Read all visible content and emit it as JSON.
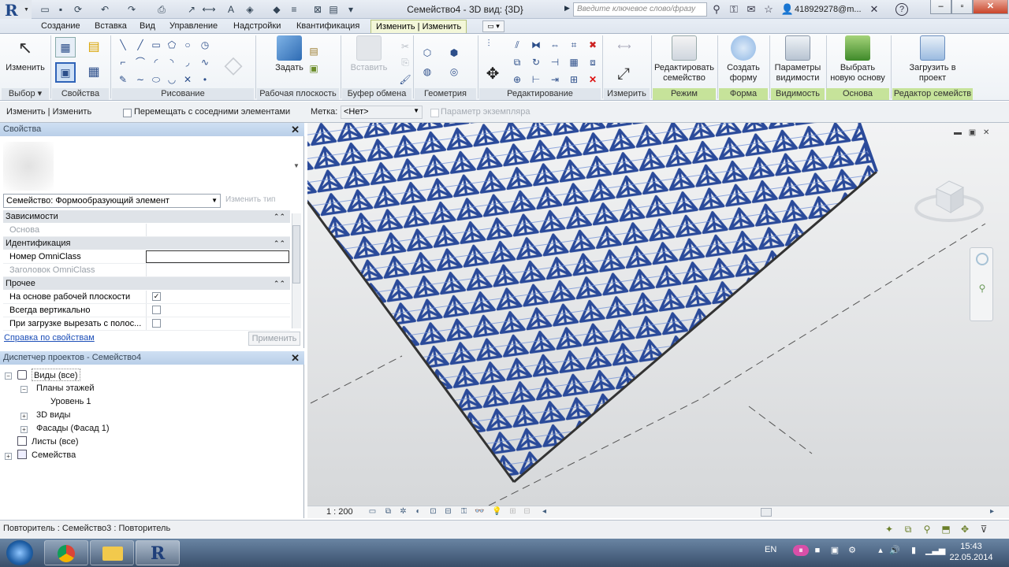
{
  "titlebar": {
    "title": "Семейство4 - 3D вид: {3D}",
    "search_placeholder": "Введите ключевое слово/фразу",
    "user": "418929278@m...",
    "help": "?"
  },
  "tabs": [
    {
      "label": "Создание"
    },
    {
      "label": "Вставка"
    },
    {
      "label": "Вид"
    },
    {
      "label": "Управление"
    },
    {
      "label": "Надстройки"
    },
    {
      "label": "Квантификация"
    },
    {
      "label": "Изменить | Изменить"
    }
  ],
  "ribbon": {
    "modify_label": "Изменить",
    "plane_set_label": "Задать",
    "paste_label": "Вставить",
    "edit_profile_label": "Редактировать семейство",
    "create_form_label": "Создать форму",
    "visibility_label": "Параметры видимости",
    "pick_host_label": "Выбрать новую основу",
    "load_label": "Загрузить в проект",
    "panels": [
      {
        "label": "Выбор"
      },
      {
        "label": "Свойства"
      },
      {
        "label": "Рисование"
      },
      {
        "label": "Рабочая плоскость"
      },
      {
        "label": "Буфер обмена"
      },
      {
        "label": "Геометрия"
      },
      {
        "label": "Редактирование"
      },
      {
        "label": "Измерить"
      },
      {
        "label": "Режим"
      },
      {
        "label": "Форма"
      },
      {
        "label": "Видимость"
      },
      {
        "label": "Основа"
      },
      {
        "label": "Редактор семейств"
      }
    ]
  },
  "options_bar": {
    "context": "Изменить | Изменить",
    "move_with_nearby": "Перемещать с соседними элементами",
    "label_caption": "Метка:",
    "label_value": "<Нет>",
    "label_param": "Параметр экземпляра"
  },
  "properties": {
    "title": "Свойства",
    "family": "Семейство: Формообразующий элемент",
    "edit_type": "Изменить тип",
    "categories": {
      "constraints": "Зависимости",
      "identity": "Идентификация",
      "other": "Прочее"
    },
    "rows": {
      "host": "Основа",
      "omniclass_number": "Номер OmniClass",
      "omniclass_title": "Заголовок OmniClass",
      "work_plane_based": "На основе рабочей плоскости",
      "always_vertical": "Всегда вертикально",
      "cut_with_voids": "При загрузке вырезать с полос..."
    },
    "help_link": "Справка по свойствам",
    "apply": "Применить"
  },
  "browser": {
    "title": "Диспетчер проектов - Семейство4",
    "items": [
      {
        "label": "Виды (все)"
      },
      {
        "label": "Планы этажей"
      },
      {
        "label": "Уровень 1"
      },
      {
        "label": "3D виды"
      },
      {
        "label": "Фасады (Фасад 1)"
      },
      {
        "label": "Листы (все)"
      },
      {
        "label": "Семейства"
      }
    ]
  },
  "viewbar": {
    "scale": "1 : 200"
  },
  "status": {
    "text": "Повторитель : Семейство3 : Повторитель"
  },
  "taskbar": {
    "lang": "EN",
    "time": "15:43",
    "date": "22.05.2014"
  },
  "colors": {
    "structure": "#2a4a9a",
    "active_tab": "#f3f7d9",
    "panel_green": "#c6e39a"
  }
}
